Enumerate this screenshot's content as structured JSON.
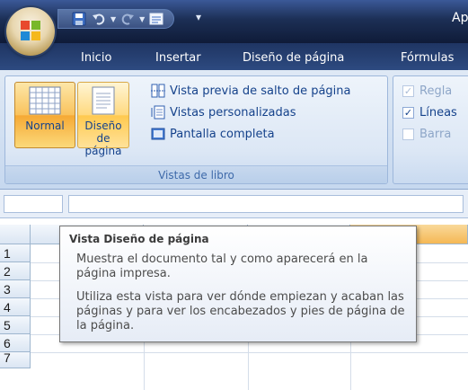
{
  "window": {
    "title": "Ap"
  },
  "quick_access": [
    "save-icon",
    "undo-icon",
    "redo-icon",
    "view-toggle-icon",
    "customize-qat-icon"
  ],
  "tabs": [
    {
      "label": "Inicio",
      "active": false
    },
    {
      "label": "Insertar",
      "active": false
    },
    {
      "label": "Diseño de página",
      "active": false
    },
    {
      "label": "Fórmulas",
      "active": false
    }
  ],
  "ribbon": {
    "vistas_group": {
      "label": "Vistas de libro",
      "normal_label": "Normal",
      "diseno_label": "Diseño de página",
      "diseno_line1": "Diseño",
      "diseno_line2": "de página",
      "vista_previa": "Vista previa de salto de página",
      "vistas_personalizadas": "Vistas personalizadas",
      "pantalla_completa": "Pantalla completa"
    },
    "mostrar_group": {
      "regla": "Regla",
      "regla_checked": true,
      "lineas": "Líneas",
      "lineas_checked": true,
      "barra": "Barra",
      "barra_checked": false
    }
  },
  "sheet": {
    "rows": [
      "1",
      "2",
      "3",
      "4",
      "5",
      "6",
      "7"
    ]
  },
  "tooltip": {
    "title": "Vista Diseño de página",
    "p1": "Muestra el documento tal y como aparecerá en la página impresa.",
    "p2": "Utiliza esta vista para ver dónde empiezan y acaban las páginas y para ver los encabezados y pies de página de la página."
  }
}
